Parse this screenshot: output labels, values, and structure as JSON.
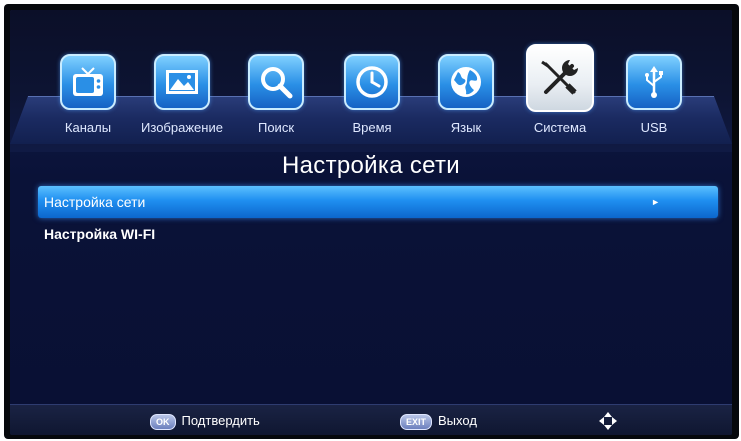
{
  "colors": {
    "accent": "#1f8ff0",
    "background": "#0a1238",
    "text": "#ffffff"
  },
  "menu": {
    "tabs": [
      {
        "label": "Каналы",
        "icon": "tv-icon",
        "active": false
      },
      {
        "label": "Изображение",
        "icon": "picture-icon",
        "active": false
      },
      {
        "label": "Поиск",
        "icon": "search-icon",
        "active": false
      },
      {
        "label": "Время",
        "icon": "clock-icon",
        "active": false
      },
      {
        "label": "Язык",
        "icon": "globe-icon",
        "active": false
      },
      {
        "label": "Система",
        "icon": "tools-icon",
        "active": true
      },
      {
        "label": "USB",
        "icon": "usb-icon",
        "active": false
      }
    ]
  },
  "page": {
    "title": "Настройка сети"
  },
  "list": {
    "items": [
      {
        "label": "Настройка сети",
        "selected": true,
        "has_submenu": true
      },
      {
        "label": "Настройка WI-FI",
        "selected": false,
        "has_submenu": false
      }
    ],
    "submenu_arrow": "►"
  },
  "footer": {
    "ok": {
      "key": "OK",
      "label": "Подтвердить"
    },
    "exit": {
      "key": "EXIT",
      "label": "Выход"
    },
    "nav_icon": "navigation-arrows-icon"
  }
}
